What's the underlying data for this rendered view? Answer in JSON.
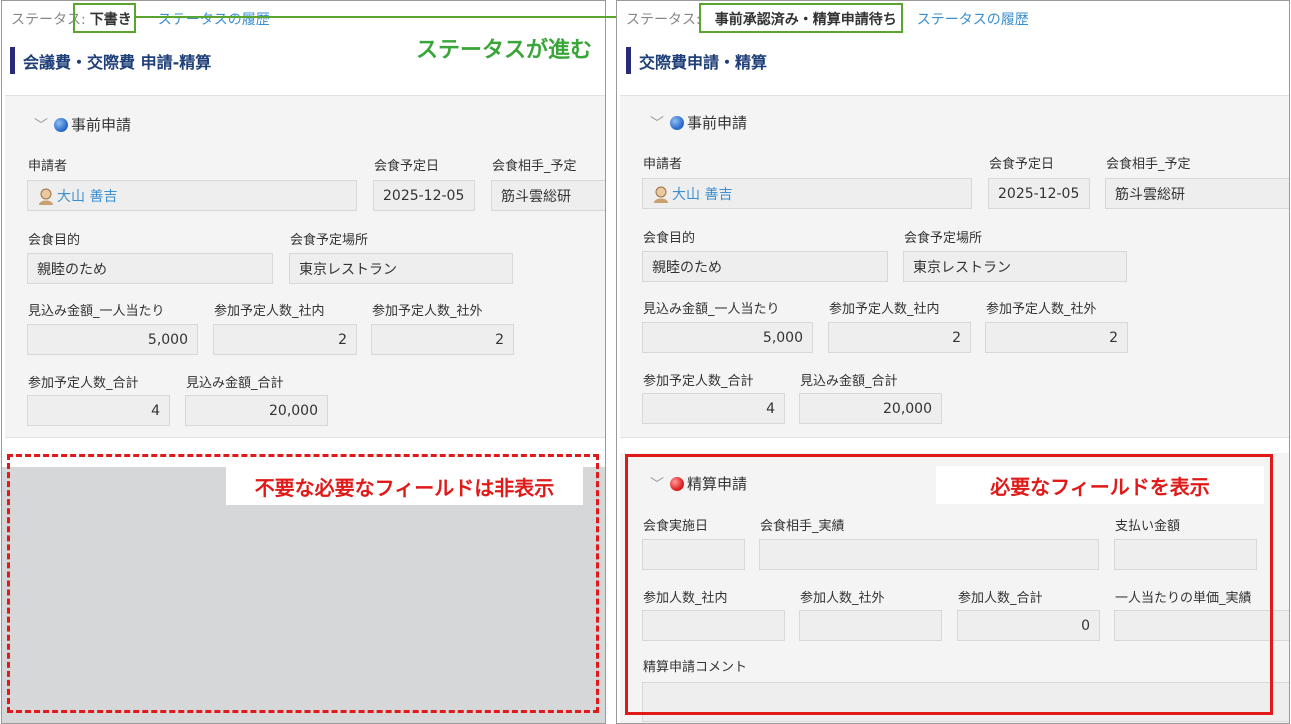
{
  "colors": {
    "green_accent": "#5aa52f",
    "green_text": "#3aa63a",
    "red_accent": "#e01919",
    "link": "#3b8fd1",
    "title": "#1f3f78"
  },
  "arrow_icon": "right-arrow-icon",
  "left": {
    "status_label": "ステータス:",
    "status_value": "下書き",
    "status_history": "ステータスの履歴",
    "title": "会議費・交際費 申請-精算",
    "callout": "ステータスが進む",
    "section": {
      "title": "事前申請",
      "fields": {
        "applicant": {
          "label": "申請者",
          "value": "大山 善吉"
        },
        "date": {
          "label": "会食予定日",
          "value": "2025-12-05"
        },
        "partner": {
          "label": "会食相手_予定",
          "value": "筋斗雲総研"
        },
        "purpose": {
          "label": "会食目的",
          "value": "親睦のため"
        },
        "place": {
          "label": "会食予定場所",
          "value": "東京レストラン"
        },
        "per_person": {
          "label": "見込み金額_一人当たり",
          "value": "5,000"
        },
        "internal": {
          "label": "参加予定人数_社内",
          "value": "2"
        },
        "external": {
          "label": "参加予定人数_社外",
          "value": "2"
        },
        "total_people": {
          "label": "参加予定人数_合計",
          "value": "4"
        },
        "total_amount": {
          "label": "見込み金額_合計",
          "value": "20,000"
        }
      }
    },
    "hidden_note": "不要な必要なフィールドは非表示"
  },
  "right": {
    "status_label": "ステータス:",
    "status_value": "事前承認済み・精算申請待ち",
    "status_history": "ステータスの履歴",
    "title": "交際費申請・精算",
    "section": {
      "title": "事前申請",
      "fields": {
        "applicant": {
          "label": "申請者",
          "value": "大山 善吉"
        },
        "date": {
          "label": "会食予定日",
          "value": "2025-12-05"
        },
        "partner": {
          "label": "会食相手_予定",
          "value": "筋斗雲総研"
        },
        "purpose": {
          "label": "会食目的",
          "value": "親睦のため"
        },
        "place": {
          "label": "会食予定場所",
          "value": "東京レストラン"
        },
        "per_person": {
          "label": "見込み金額_一人当たり",
          "value": "5,000"
        },
        "internal": {
          "label": "参加予定人数_社内",
          "value": "2"
        },
        "external": {
          "label": "参加予定人数_社外",
          "value": "2"
        },
        "total_people": {
          "label": "参加予定人数_合計",
          "value": "4"
        },
        "total_amount": {
          "label": "見込み金額_合計",
          "value": "20,000"
        }
      }
    },
    "settlement": {
      "title": "精算申請",
      "shown_note": "必要なフィールドを表示",
      "fields": {
        "held_date": {
          "label": "会食実施日",
          "value": ""
        },
        "partner_actual": {
          "label": "会食相手_実績",
          "value": ""
        },
        "paid_amount": {
          "label": "支払い金額",
          "value": ""
        },
        "internal": {
          "label": "参加人数_社内",
          "value": ""
        },
        "external": {
          "label": "参加人数_社外",
          "value": ""
        },
        "total": {
          "label": "参加人数_合計",
          "value": "0"
        },
        "unit_price": {
          "label": "一人当たりの単価_実績",
          "value": ""
        },
        "comment": {
          "label": "精算申請コメント",
          "value": ""
        }
      }
    }
  }
}
